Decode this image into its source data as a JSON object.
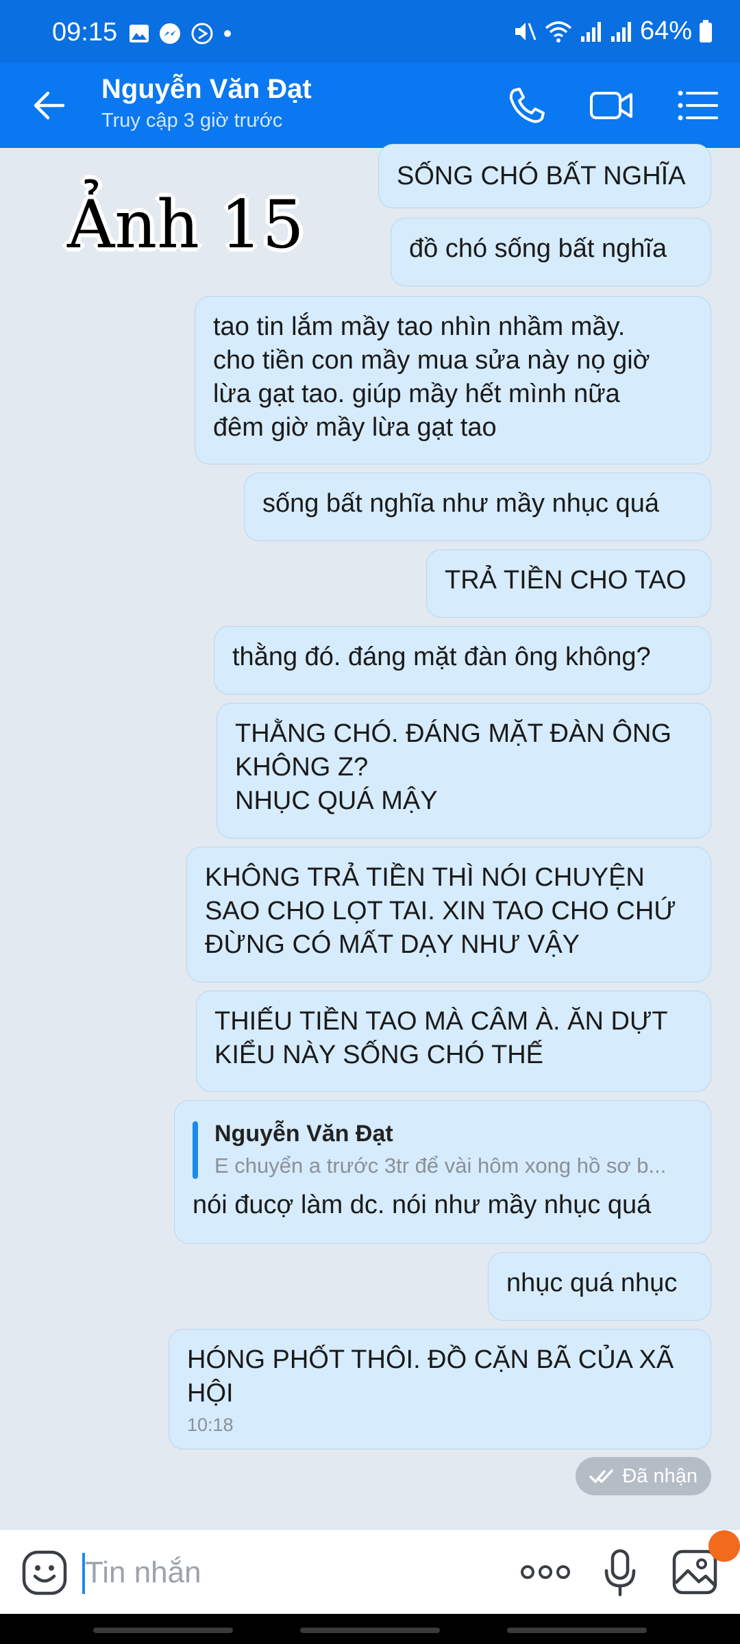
{
  "status_bar": {
    "time": "09:15",
    "battery": "64%"
  },
  "header": {
    "contact_name": "Nguyễn Văn Đạt",
    "last_seen": "Truy cập 3 giờ trước"
  },
  "overlay_label": "Ảnh 15",
  "messages": [
    {
      "text": "SỐNG CHÓ BẤT NGHĨA"
    },
    {
      "text": "đồ chó sống bất nghĩa"
    },
    {
      "text": "tao tin lắm mầy tao nhìn nhầm mầy.\ncho tiền con mầy mua sửa này nọ giờ\nlừa gạt tao. giúp mầy hết mình nữa\nđêm giờ mầy lừa gạt tao"
    },
    {
      "text": "sống bất nghĩa như mầy nhục quá"
    },
    {
      "text": "TRẢ TIỀN CHO TAO"
    },
    {
      "text": "thằng đó. đáng mặt đàn ông không?"
    },
    {
      "text": "THẰNG CHÓ. ĐÁNG MẶT ĐÀN ÔNG\nKHÔNG Z?\nNHỤC QUÁ MẬY"
    },
    {
      "text": "KHÔNG TRẢ TIỀN THÌ NÓI CHUYỆN\nSAO CHO LỌT TAI. XIN TAO CHO CHỨ\nĐỪNG CÓ MẤT DẠY NHƯ VẬY"
    },
    {
      "text": "THIẾU TIỀN TAO MÀ CÂM À. ĂN DỰT\nKIỂU NÀY SỐNG CHÓ THẾ"
    },
    {
      "quote_name": "Nguyễn Văn Đạt",
      "quote_snippet": "E chuyển a trước 3tr để vài hôm xong hồ sơ b...",
      "text": "nói đucợ làm dc. nói như mầy nhục quá"
    },
    {
      "text": "nhục quá nhục"
    },
    {
      "text": "HÓNG PHỐT THÔI. ĐỒ CẶN BÃ CỦA XÃ\nHỘI",
      "time": "10:18"
    }
  ],
  "delivery_status": "Đã nhận",
  "composer": {
    "placeholder": "Tin nhắn"
  },
  "colors": {
    "header": "#0a78f0",
    "status_bar": "#0a6fe0",
    "bubble": "#d6ebfb",
    "background": "#e3e9f0"
  }
}
